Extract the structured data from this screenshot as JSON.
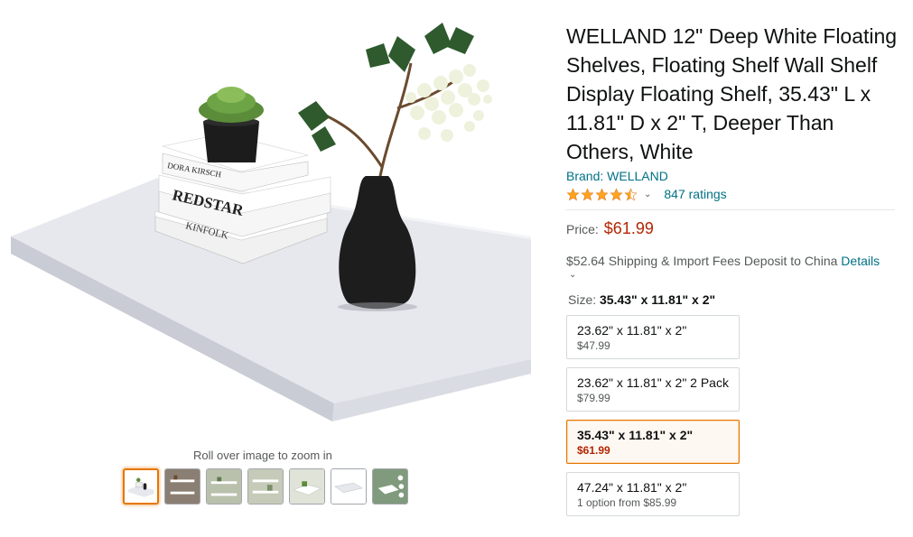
{
  "product": {
    "title": "WELLAND 12\" Deep White Floating Shelves, Floating Shelf Wall Shelf Display Floating Shelf, 35.43\" L x 11.81\" D x 2\" T, Deeper Than Others, White",
    "brand": "Brand: WELLAND",
    "rating_value": 4.5,
    "ratings_count": "847 ratings",
    "price_label": "Price:",
    "price": "$61.99",
    "shipping_text": "$52.64 Shipping & Import Fees Deposit to China",
    "shipping_details": "Details",
    "size_label": "Size:",
    "size_selected": "35.43\" x 11.81\" x 2\""
  },
  "gallery": {
    "zoom_hint": "Roll over image to zoom in",
    "book_top": "DORA KIRSCH",
    "book_mid": "REDSTAR",
    "book_bottom": "KINFOLK"
  },
  "size_options": [
    {
      "dimensions": "23.62\" x 11.81\" x 2\"",
      "price": "$47.99"
    },
    {
      "dimensions": "23.62\" x 11.81\" x 2\" 2 Pack",
      "price": "$79.99"
    },
    {
      "dimensions": "35.43\" x 11.81\" x 2\"",
      "price": "$61.99"
    },
    {
      "dimensions": "47.24\" x 11.81\" x 2\"",
      "price": "1 option from $85.99"
    }
  ],
  "colors": {
    "link": "#007185",
    "price": "#b12704",
    "star": "#ffa41c",
    "selected_border": "#e77600"
  },
  "icons": [
    "star-icon",
    "caret-down-icon",
    "chevron-down-icon"
  ]
}
